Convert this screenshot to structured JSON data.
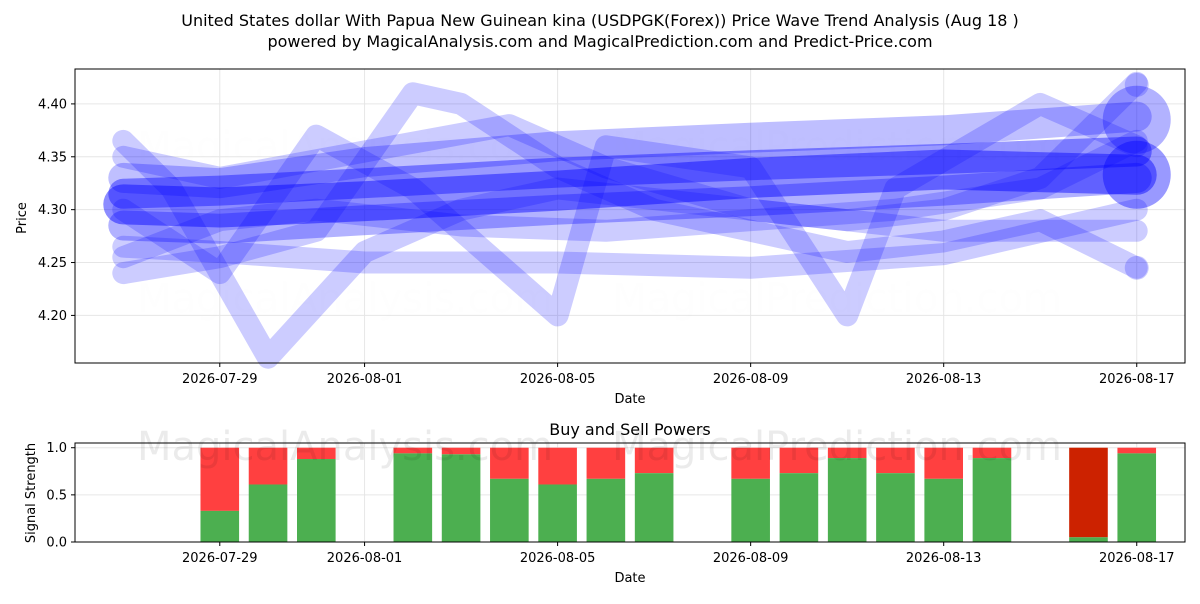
{
  "header": {
    "title": "United States dollar With Papua New Guinean kina (USDPGK(Forex)) Price Wave Trend Analysis (Aug 18 )",
    "subtitle": "powered by MagicalAnalysis.com and MagicalPrediction.com and Predict-Price.com"
  },
  "watermarks": {
    "analysis": "MagicalAnalysis.com",
    "prediction": "MagicalPrediction.com"
  },
  "colors": {
    "wave": "#0000ff",
    "buy": "#4caf50",
    "sell": "#ff4040",
    "sell_strong": "#cc2200",
    "grid": "#e6e6e6"
  },
  "chart_data": [
    {
      "type": "line",
      "xlabel": "Date",
      "ylabel": "Price",
      "xticks": [
        "2026-07-29",
        "2026-08-01",
        "2026-08-05",
        "2026-08-09",
        "2026-08-13",
        "2026-08-17"
      ],
      "yticks": [
        "4.20",
        "4.25",
        "4.30",
        "4.35",
        "4.40"
      ],
      "xlim": [
        "2026-07-26",
        "2026-08-18"
      ],
      "ylim": [
        4.155,
        4.433
      ],
      "grid": true,
      "series": [
        {
          "width": 40,
          "opacity": 0.45,
          "x": [
            "2026-07-27",
            "2026-07-29",
            "2026-08-01",
            "2026-08-05",
            "2026-08-09",
            "2026-08-13",
            "2026-08-17"
          ],
          "y": [
            4.305,
            4.302,
            4.308,
            4.318,
            4.33,
            4.338,
            4.333
          ]
        },
        {
          "width": 30,
          "opacity": 0.4,
          "x": [
            "2026-07-27",
            "2026-07-29",
            "2026-08-01",
            "2026-08-05",
            "2026-08-09",
            "2026-08-13",
            "2026-08-17"
          ],
          "y": [
            4.315,
            4.318,
            4.325,
            4.335,
            4.342,
            4.348,
            4.355
          ]
        },
        {
          "width": 30,
          "opacity": 0.3,
          "x": [
            "2026-07-27",
            "2026-07-29",
            "2026-08-01",
            "2026-08-05",
            "2026-08-09",
            "2026-08-13",
            "2026-08-17"
          ],
          "y": [
            4.285,
            4.282,
            4.29,
            4.3,
            4.308,
            4.318,
            4.33
          ]
        },
        {
          "width": 30,
          "opacity": 0.25,
          "x": [
            "2026-07-27",
            "2026-07-29",
            "2026-08-01",
            "2026-08-05",
            "2026-08-09",
            "2026-08-13",
            "2026-08-17"
          ],
          "y": [
            4.33,
            4.325,
            4.345,
            4.36,
            4.368,
            4.375,
            4.388
          ]
        },
        {
          "width": 22,
          "opacity": 0.2,
          "x": [
            "2026-07-27",
            "2026-07-28",
            "2026-07-30",
            "2026-08-01",
            "2026-08-03",
            "2026-08-05",
            "2026-08-07",
            "2026-08-09",
            "2026-08-11",
            "2026-08-13",
            "2026-08-15",
            "2026-08-17"
          ],
          "y": [
            4.365,
            4.32,
            4.16,
            4.26,
            4.3,
            4.32,
            4.31,
            4.3,
            4.29,
            4.3,
            4.33,
            4.42
          ]
        },
        {
          "width": 22,
          "opacity": 0.2,
          "x": [
            "2026-07-27",
            "2026-07-29",
            "2026-07-31",
            "2026-08-02",
            "2026-08-03",
            "2026-08-05",
            "2026-08-07",
            "2026-08-09",
            "2026-08-11",
            "2026-08-13",
            "2026-08-15",
            "2026-08-17"
          ],
          "y": [
            4.24,
            4.255,
            4.28,
            4.41,
            4.4,
            4.34,
            4.3,
            4.28,
            4.26,
            4.27,
            4.29,
            4.245
          ]
        },
        {
          "width": 22,
          "opacity": 0.2,
          "x": [
            "2026-07-27",
            "2026-07-29",
            "2026-07-31",
            "2026-08-02",
            "2026-08-03",
            "2026-08-05",
            "2026-08-06",
            "2026-08-09",
            "2026-08-11",
            "2026-08-12",
            "2026-08-15",
            "2026-08-17"
          ],
          "y": [
            4.3,
            4.24,
            4.37,
            4.32,
            4.28,
            4.2,
            4.36,
            4.34,
            4.2,
            4.32,
            4.4,
            4.36
          ]
        },
        {
          "width": 22,
          "opacity": 0.2,
          "x": [
            "2026-07-27",
            "2026-07-29",
            "2026-08-01",
            "2026-08-05",
            "2026-08-09",
            "2026-08-13",
            "2026-08-17"
          ],
          "y": [
            4.265,
            4.26,
            4.25,
            4.25,
            4.245,
            4.258,
            4.3
          ]
        },
        {
          "width": 22,
          "opacity": 0.2,
          "x": [
            "2026-07-27",
            "2026-07-29",
            "2026-08-01",
            "2026-08-04",
            "2026-08-06",
            "2026-08-09",
            "2026-08-13",
            "2026-08-17"
          ],
          "y": [
            4.35,
            4.33,
            4.355,
            4.38,
            4.34,
            4.3,
            4.28,
            4.28
          ]
        },
        {
          "width": 22,
          "opacity": 0.2,
          "x": [
            "2026-07-27",
            "2026-07-29",
            "2026-07-31",
            "2026-08-03",
            "2026-08-06",
            "2026-08-09",
            "2026-08-12",
            "2026-08-15",
            "2026-08-17"
          ],
          "y": [
            4.255,
            4.29,
            4.3,
            4.285,
            4.28,
            4.29,
            4.3,
            4.32,
            4.365
          ]
        }
      ],
      "endpoints": [
        {
          "x": "2026-08-17",
          "y": 4.385,
          "r": 34,
          "opacity": 0.3
        },
        {
          "x": "2026-08-17",
          "y": 4.333,
          "r": 34,
          "opacity": 0.4
        },
        {
          "x": "2026-08-17",
          "y": 4.418,
          "r": 12,
          "opacity": 0.2
        },
        {
          "x": "2026-08-17",
          "y": 4.245,
          "r": 12,
          "opacity": 0.2
        }
      ]
    },
    {
      "type": "bar",
      "title": "Buy and Sell Powers",
      "xlabel": "Date",
      "ylabel": "Signal Strength",
      "xticks": [
        "2026-07-29",
        "2026-08-01",
        "2026-08-05",
        "2026-08-09",
        "2026-08-13",
        "2026-08-17"
      ],
      "yticks": [
        "0.0",
        "0.5",
        "1.0"
      ],
      "xlim": [
        "2026-07-26",
        "2026-08-18"
      ],
      "ylim": [
        0,
        1.05
      ],
      "grid": true,
      "series": [
        {
          "name": "Buy",
          "color": "buy"
        },
        {
          "name": "Sell",
          "color": "sell"
        }
      ],
      "bars": [
        {
          "date": "2026-07-29",
          "buy": 0.33
        },
        {
          "date": "2026-07-30",
          "buy": 0.61
        },
        {
          "date": "2026-07-31",
          "buy": 0.88
        },
        {
          "date": "2026-08-02",
          "buy": 0.94
        },
        {
          "date": "2026-08-03",
          "buy": 0.93
        },
        {
          "date": "2026-08-04",
          "buy": 0.67
        },
        {
          "date": "2026-08-05",
          "buy": 0.61
        },
        {
          "date": "2026-08-06",
          "buy": 0.67
        },
        {
          "date": "2026-08-07",
          "buy": 0.73
        },
        {
          "date": "2026-08-09",
          "buy": 0.67
        },
        {
          "date": "2026-08-10",
          "buy": 0.73
        },
        {
          "date": "2026-08-11",
          "buy": 0.89
        },
        {
          "date": "2026-08-12",
          "buy": 0.73
        },
        {
          "date": "2026-08-13",
          "buy": 0.67
        },
        {
          "date": "2026-08-14",
          "buy": 0.89
        },
        {
          "date": "2026-08-16",
          "buy": 0.05,
          "strong_sell": true
        },
        {
          "date": "2026-08-17",
          "buy": 0.94
        }
      ]
    }
  ]
}
